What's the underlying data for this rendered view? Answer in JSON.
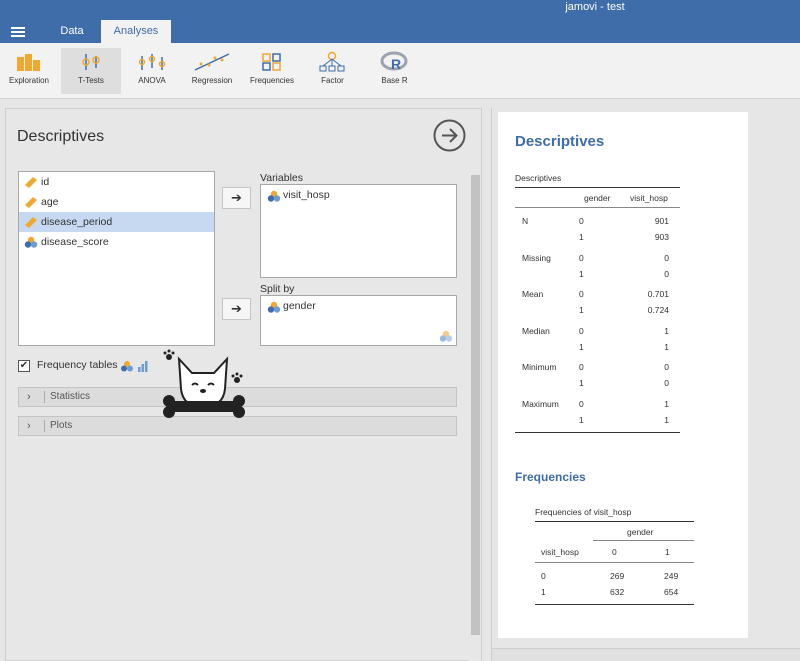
{
  "window": {
    "title": "jamovi - test"
  },
  "tabs": [
    {
      "label": "Data"
    },
    {
      "label": "Analyses"
    }
  ],
  "ribbon": [
    {
      "label": "Exploration",
      "icon": "exploration-icon"
    },
    {
      "label": "T-Tests",
      "icon": "ttests-icon"
    },
    {
      "label": "ANOVA",
      "icon": "anova-icon"
    },
    {
      "label": "Regression",
      "icon": "regression-icon"
    },
    {
      "label": "Frequencies",
      "icon": "frequencies-icon"
    },
    {
      "label": "Factor",
      "icon": "factor-icon"
    },
    {
      "label": "Base R",
      "icon": "r-icon"
    }
  ],
  "options": {
    "title": "Descriptives",
    "variables": [
      {
        "name": "id",
        "type": "continuous"
      },
      {
        "name": "age",
        "type": "continuous"
      },
      {
        "name": "disease_period",
        "type": "continuous"
      },
      {
        "name": "disease_score",
        "type": "nominal"
      }
    ],
    "variables_label": "Variables",
    "variables_selected": [
      {
        "name": "visit_hosp"
      }
    ],
    "splitby_label": "Split by",
    "splitby_selected": [
      {
        "name": "gender"
      }
    ],
    "frequency_tables_label": "Frequency tables",
    "frequency_tables_checked": true,
    "sections": [
      {
        "label": "Statistics"
      },
      {
        "label": "Plots"
      }
    ]
  },
  "results": {
    "title": "Descriptives",
    "desc_table": {
      "title": "Descriptives",
      "headers": [
        "gender",
        "visit_hosp"
      ],
      "rows": [
        {
          "stat": "N",
          "g0": "0",
          "v0": "901",
          "g1": "1",
          "v1": "903"
        },
        {
          "stat": "Missing",
          "g0": "0",
          "v0": "0",
          "g1": "1",
          "v1": "0"
        },
        {
          "stat": "Mean",
          "g0": "0",
          "v0": "0.701",
          "g1": "1",
          "v1": "0.724"
        },
        {
          "stat": "Median",
          "g0": "0",
          "v0": "1",
          "g1": "1",
          "v1": "1"
        },
        {
          "stat": "Minimum",
          "g0": "0",
          "v0": "0",
          "g1": "1",
          "v1": "0"
        },
        {
          "stat": "Maximum",
          "g0": "0",
          "v0": "1",
          "g1": "1",
          "v1": "1"
        }
      ]
    },
    "freq_heading": "Frequencies",
    "freq_table": {
      "title": "Frequencies of visit_hosp",
      "group_header": "gender",
      "row_header": "visit_hosp",
      "col_headers": [
        "0",
        "1"
      ],
      "rows": [
        {
          "label": "0",
          "values": [
            "269",
            "249"
          ]
        },
        {
          "label": "1",
          "values": [
            "632",
            "654"
          ]
        }
      ]
    }
  },
  "colors": {
    "brand": "#3e6da9",
    "selected": "#c6d9f1",
    "ruler": "#f5a623"
  }
}
